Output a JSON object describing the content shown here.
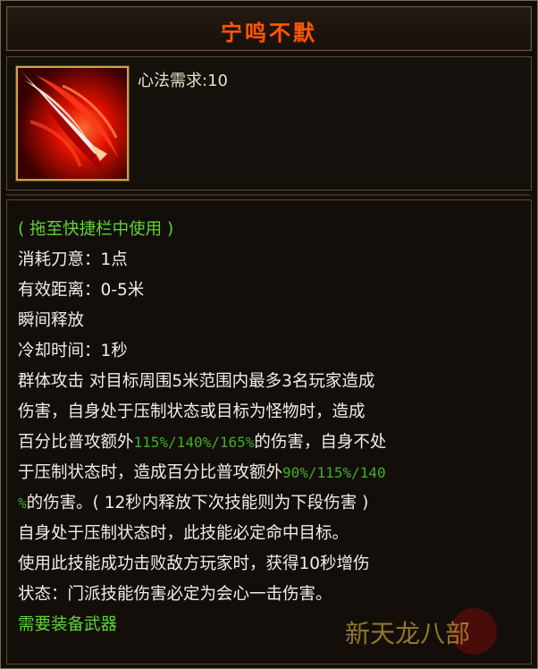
{
  "title": "宁鸣不默",
  "requirement": "心法需求:10",
  "usage_hint": "( 拖至快捷栏中使用 )",
  "cost": "消耗刀意：1点",
  "range": "有效距离：0-5米",
  "cast_type": "瞬间释放",
  "cooldown": "冷却时间：1秒",
  "description": {
    "l1": "群体攻击 对目标周围5米范围内最多3名玩家造成",
    "l2": "伤害，自身处于压制状态或目标为怪物时，造成",
    "l3a": "百分比普攻额外",
    "l3b": "115%/140%/165%",
    "l3c": "的伤害，自身不处",
    "l4a": "于压制状态时，造成百分比普攻额外",
    "l4b": "90%/115%/140",
    "l5a": "%",
    "l5b": "的伤害。( 12秒内释放下次技能则为下段伤害 )",
    "l6": "自身处于压制状态时，此技能必定命中目标。",
    "l7": "使用此技能成功击败敌方玩家时，获得10秒增伤",
    "l8": "状态：门派技能伤害必定为会心一击伤害。"
  },
  "requirement_weapon": "需要装备武器",
  "watermark": "新天龙八部",
  "colors": {
    "title": "#f25a0d",
    "text": "#f2eee6",
    "green_text": "#5ed43a",
    "percent": "#3fae2a",
    "icon_frame": "#c9a646"
  },
  "icons": {
    "skill_icon": "red-blade-slash-icon"
  }
}
